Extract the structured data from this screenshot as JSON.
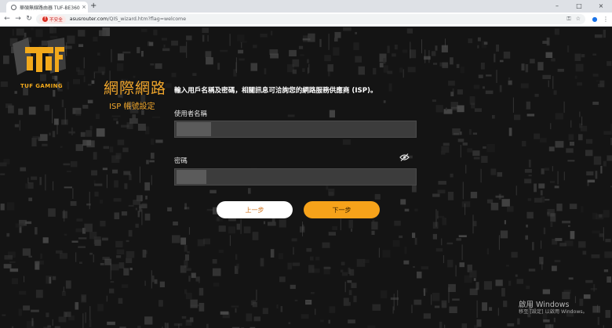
{
  "browser": {
    "tab_title": "華碩無線路由器 TUF-BE3600 ...",
    "tab_close": "×",
    "new_tab": "+",
    "minimize": "–",
    "maximize": "□",
    "close": "×",
    "back": "←",
    "forward": "→",
    "reload": "↻",
    "security_label": "不安全",
    "url_host": "asusrouter.com",
    "url_path": "/QIS_wizard.htm?flag=welcome",
    "menu": "⋮"
  },
  "brand": {
    "logo_text": "TUF GAMING"
  },
  "wizard": {
    "title": "網際網路",
    "subtitle": "ISP 帳號設定",
    "intro": "輸入用戶名稱及密碼，相關訊息可洽詢您的網路服務供應商 (ISP)。",
    "username_label": "使用者名稱",
    "username_value": "",
    "password_label": "密碼",
    "password_value": "",
    "prev_button": "上一步",
    "next_button": "下一步"
  },
  "watermark": {
    "line1": "啟用 Windows",
    "line2": "移至 [設定] 以啟用 Windows。"
  },
  "colors": {
    "accent": "#f6a21a",
    "title": "#f0a62c",
    "background": "#141414"
  }
}
